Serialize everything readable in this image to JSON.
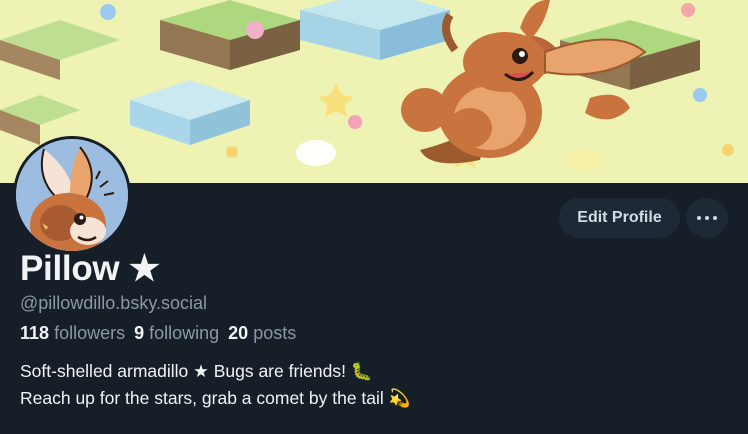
{
  "profile": {
    "display_name": "Pillow ★",
    "handle": "@pillowdillo.bsky.social",
    "followers_count": "118",
    "followers_label": "followers",
    "following_count": "9",
    "following_label": "following",
    "posts_count": "20",
    "posts_label": "posts",
    "bio_line_1": "Soft-shelled armadillo ★ Bugs are friends! 🐛",
    "bio_line_2": "Reach up for the stars, grab a comet by the tail 💫"
  },
  "actions": {
    "edit_profile_label": "Edit Profile",
    "more_icon": "more-horizontal-icon"
  },
  "colors": {
    "background": "#161e27",
    "button_bg": "#1e2936",
    "text_primary": "#f1f3f5",
    "text_secondary": "#8b98a6",
    "banner_bg": "#eef3b4",
    "avatar_bg": "#9cbde0"
  }
}
